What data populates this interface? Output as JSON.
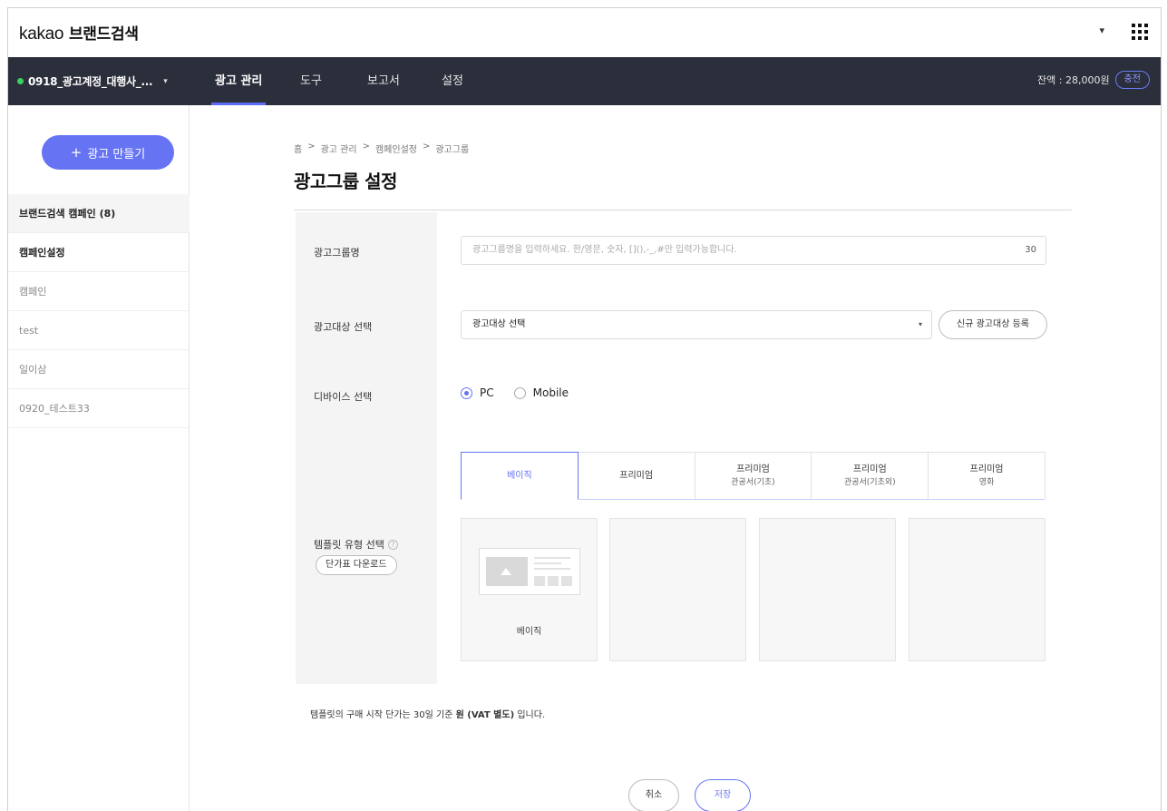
{
  "header": {
    "logo_kakao": "kakao",
    "logo_brand": "브랜드검색",
    "dropdown_caret": "▾"
  },
  "nav": {
    "account": "0918_광고계정_대행사_...",
    "account_caret": "▾",
    "items": [
      "광고 관리",
      "도구",
      "보고서",
      "설정"
    ],
    "active_index": 0,
    "balance": "잔액 : 28,000원",
    "charge": "충전"
  },
  "sidebar": {
    "create_button": "광고 만들기",
    "create_icon": "+",
    "items": [
      "브랜드검색 캠페인 (8)",
      "캠페인설정",
      "캠페인",
      "test",
      "일이삼",
      "0920_테스트33"
    ]
  },
  "main": {
    "breadcrumb": [
      "홈",
      ">",
      "광고 관리",
      ">",
      "캠페인설정",
      ">",
      "광고그룹"
    ],
    "title": "광고그룹 설정",
    "labels": {
      "group_name": "광고그룹명",
      "target": "광고대상 선택",
      "device": "디바이스 선택",
      "template": "템플릿 유형 선택"
    },
    "group_name_placeholder": "광고그룹명을 입력하세요. 한/영문, 숫자, [](),-_,#만 입력가능합니다.",
    "group_name_count": "30",
    "target_select": "광고대상 선택",
    "target_arrow": "▾",
    "new_target_button": "신규 광고대상 등록",
    "device_options": [
      "PC",
      "Mobile"
    ],
    "device_selected": "PC",
    "help_icon": "?",
    "price_download_button": "단가표 다운로드",
    "tabs": [
      {
        "label": "베이직",
        "sub": ""
      },
      {
        "label": "프리미엄",
        "sub": ""
      },
      {
        "label": "프리미엄",
        "sub": "관공서(기초)"
      },
      {
        "label": "프리미엄",
        "sub": "관공서(기초외)"
      },
      {
        "label": "프리미엄",
        "sub": "영화"
      }
    ],
    "active_tab": 0,
    "template_cards": [
      "베이직",
      "",
      "",
      ""
    ],
    "note_prefix": "템플릿의 구매 시작 단가는 30일 기준",
    "note_bold": "원 (VAT 별도)",
    "note_suffix": "입니다.",
    "cancel_button": "취소",
    "save_button": "저장"
  },
  "colors": {
    "accent": "#6674f3",
    "nav_bg": "#2b2e3b",
    "status_dot": "#3ad15d"
  }
}
